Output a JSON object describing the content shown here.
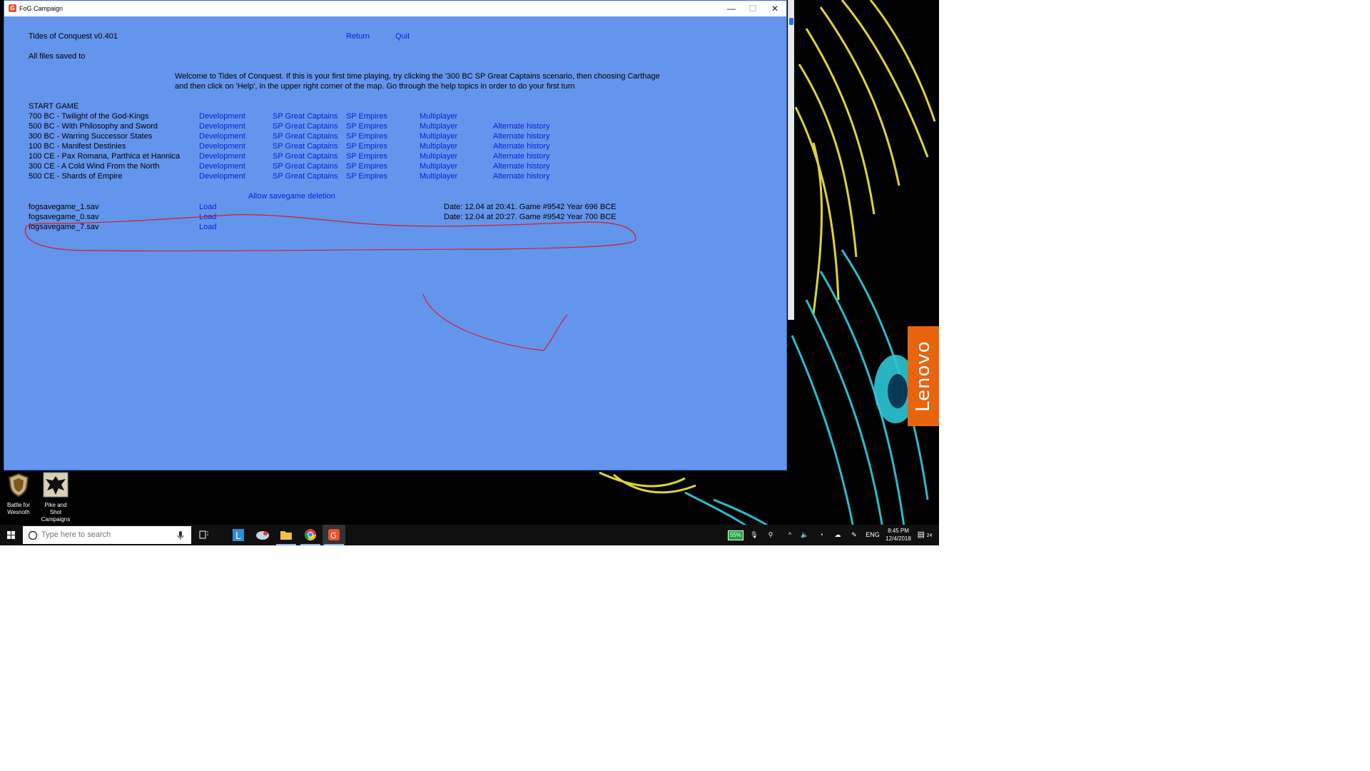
{
  "window": {
    "title": "FoG Campaign",
    "controls": {
      "minimize": "—",
      "maximize": "☐",
      "close": "✕"
    }
  },
  "header": {
    "app_name": "Tides of Conquest v0.401",
    "return_label": "Return",
    "quit_label": "Quit",
    "saved_to": "All files saved to"
  },
  "welcome": {
    "line1": "Welcome to Tides of Conquest. If this is your first time playing, try clicking the '300 BC SP Great Captains scenario, then choosing Carthage",
    "line2": "and then click on 'Help', in the upper right corner of the map. Go through the help topics in order to do your first turn"
  },
  "start_game": {
    "heading": "START GAME",
    "scenarios": [
      {
        "name": "700 BC - Twilight of the God-Kings",
        "development": "Development",
        "great_captains": "SP Great Captains",
        "empires": "SP Empires",
        "multiplayer": "Multiplayer",
        "alternate": ""
      },
      {
        "name": "500 BC - With Philosophy and Sword",
        "development": "Development",
        "great_captains": "SP Great Captains",
        "empires": "SP Empires",
        "multiplayer": "Multiplayer",
        "alternate": "Alternate history"
      },
      {
        "name": "300 BC - Warring Successor States",
        "development": "Development",
        "great_captains": "SP Great Captains",
        "empires": "SP Empires",
        "multiplayer": "Multiplayer",
        "alternate": "Alternate history"
      },
      {
        "name": "100 BC - Manifest Destinies",
        "development": "Development",
        "great_captains": "SP Great Captains",
        "empires": "SP Empires",
        "multiplayer": "Multiplayer",
        "alternate": "Alternate history"
      },
      {
        "name": "100 CE - Pax Romana, Parthica et Hannica",
        "development": "Development",
        "great_captains": "SP Great Captains",
        "empires": "SP Empires",
        "multiplayer": "Multiplayer",
        "alternate": "Alternate history"
      },
      {
        "name": "300 CE - A Cold Wind From the North",
        "development": "Development",
        "great_captains": "SP Great Captains",
        "empires": "SP Empires",
        "multiplayer": "Multiplayer",
        "alternate": "Alternate history"
      },
      {
        "name": "500 CE - Shards of Empire",
        "development": "Development",
        "great_captains": "SP Great Captains",
        "empires": "SP Empires",
        "multiplayer": "Multiplayer",
        "alternate": "Alternate history"
      }
    ]
  },
  "savegames": {
    "allow_deletion_label": "Allow savegame deletion",
    "files": [
      {
        "name": "fogsavegame_1.sav",
        "load": "Load",
        "info": "Date: 12.04 at 20:41. Game #9542 Year 696 BCE"
      },
      {
        "name": "fogsavegame_0.sav",
        "load": "Load",
        "info": "Date: 12.04 at 20:27. Game #9542 Year 700 BCE"
      },
      {
        "name": "fogsavegame_7.sav",
        "load": "Load",
        "info": ""
      }
    ]
  },
  "desktop": {
    "icons": [
      {
        "label_line1": "Battle for",
        "label_line2": "Wesnoth",
        "icon": "shield-icon"
      },
      {
        "label_line1": "Pike and Shot",
        "label_line2": "Campaigns",
        "icon": "eagle-icon"
      }
    ],
    "brand": "Lenovo"
  },
  "taskbar": {
    "search_placeholder": "Type here to search",
    "battery": "55%",
    "language": "ENG",
    "time": "8:45 PM",
    "date": "12/4/2018",
    "notifications": "24"
  },
  "colors": {
    "app_bg": "#6495ed",
    "link": "#0b1fd8",
    "annotation": "#d0202a",
    "lenovo": "#e8640e"
  }
}
